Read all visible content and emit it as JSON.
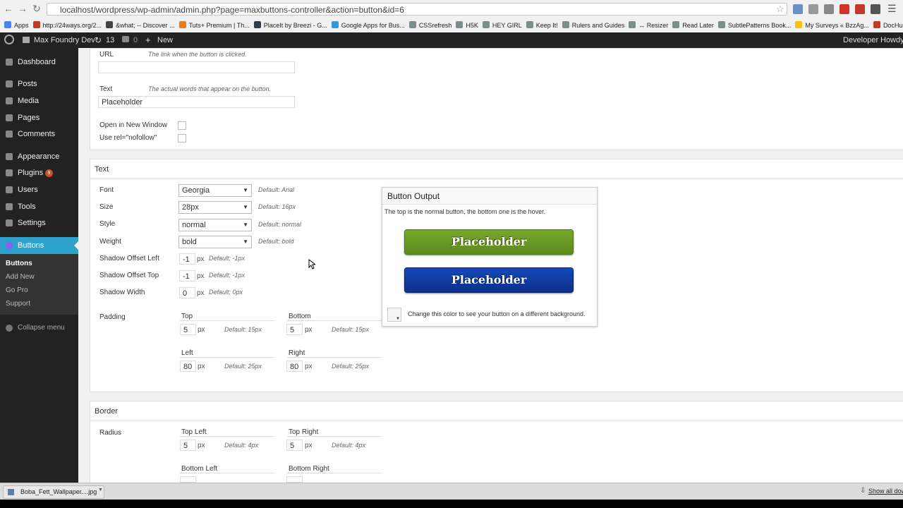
{
  "browser": {
    "url": "localhost/wordpress/wp-admin/admin.php?page=maxbuttons-controller&action=button&id=6",
    "bookmarks": [
      {
        "label": "Apps",
        "color": "#4285f4"
      },
      {
        "label": "http://24ways.org/2...",
        "color": "#c0392b"
      },
      {
        "label": "&what; -- Discover ...",
        "color": "#444444"
      },
      {
        "label": "Tuts+ Premium | Th...",
        "color": "#e67e22"
      },
      {
        "label": "PlaceIt by Breezi - G...",
        "color": "#2c3e50"
      },
      {
        "label": "Google Apps for Bus...",
        "color": "#3498db"
      },
      {
        "label": "CSSrefresh",
        "color": "#7f8c8d"
      },
      {
        "label": "H5K",
        "color": "#7f8c8d"
      },
      {
        "label": "HEY GIRL",
        "color": "#7f8c8d"
      },
      {
        "label": "Keep It!",
        "color": "#7f8c8d"
      },
      {
        "label": "Rulers and Guides",
        "color": "#7f8c8d"
      },
      {
        "label": "↔ Resizer",
        "color": "#7f8c8d"
      },
      {
        "label": "Read Later",
        "color": "#7f8c8d"
      },
      {
        "label": "SubtlePatterns Book...",
        "color": "#7f8c8d"
      },
      {
        "label": "My Surveys « BzzAg...",
        "color": "#f1c40f"
      },
      {
        "label": "DocHub | Instant D",
        "color": "#c0392b"
      }
    ]
  },
  "adminbar": {
    "site": "Max Foundry Dev",
    "updates": "13",
    "comments": "0",
    "new": "New",
    "developer": "Developer",
    "howdy": "Howdy,"
  },
  "sidebar": {
    "items": [
      {
        "label": "Dashboard"
      },
      {
        "label": "Posts"
      },
      {
        "label": "Media"
      },
      {
        "label": "Pages"
      },
      {
        "label": "Comments"
      },
      {
        "label": "Appearance"
      },
      {
        "label": "Plugins",
        "badge": "9"
      },
      {
        "label": "Users"
      },
      {
        "label": "Tools"
      },
      {
        "label": "Settings"
      },
      {
        "label": "Buttons"
      }
    ],
    "submenu": [
      "Buttons",
      "Add New",
      "Go Pro",
      "Support"
    ],
    "collapse": "Collapse menu"
  },
  "basics": {
    "url_label": "URL",
    "url_hint": "The link when the button is clicked.",
    "url_value": "",
    "text_label": "Text",
    "text_hint": "The actual words that appear on the button.",
    "text_value": "Placeholder",
    "new_window": "Open in New Window",
    "nofollow": "Use rel=\"nofollow\""
  },
  "text_section": {
    "title": "Text",
    "font": {
      "label": "Font",
      "value": "Georgia",
      "default": "Default: Arial"
    },
    "size": {
      "label": "Size",
      "value": "28px",
      "default": "Default: 16px"
    },
    "style": {
      "label": "Style",
      "value": "normal",
      "default": "Default: normal"
    },
    "weight": {
      "label": "Weight",
      "value": "bold",
      "default": "Default: bold"
    },
    "shadow_left": {
      "label": "Shadow Offset Left",
      "value": "-1",
      "unit": "px",
      "default": "Default: -1px"
    },
    "shadow_top": {
      "label": "Shadow Offset Top",
      "value": "-1",
      "unit": "px",
      "default": "Default: -1px"
    },
    "shadow_width": {
      "label": "Shadow Width",
      "value": "0",
      "unit": "px",
      "default": "Default: 0px"
    },
    "padding": {
      "label": "Padding",
      "top": {
        "label": "Top",
        "value": "5",
        "unit": "px",
        "default": "Default: 15px"
      },
      "bottom": {
        "label": "Bottom",
        "value": "5",
        "unit": "px",
        "default": "Default: 15px"
      },
      "left": {
        "label": "Left",
        "value": "80",
        "unit": "px",
        "default": "Default: 25px"
      },
      "right": {
        "label": "Right",
        "value": "80",
        "unit": "px",
        "default": "Default: 25px"
      }
    }
  },
  "output": {
    "title": "Button Output",
    "desc": "The top is the normal button, the bottom one is the hover.",
    "button_normal": "Placeholder",
    "button_hover": "Placeholder",
    "normal_color": "#76a82c",
    "hover_color": "#1549b8",
    "bg_note": "Change this color to see your button on a different background."
  },
  "border_section": {
    "title": "Border",
    "radius_label": "Radius",
    "top_left": {
      "label": "Top Left",
      "value": "5",
      "unit": "px",
      "default": "Default: 4px"
    },
    "top_right": {
      "label": "Top Right",
      "value": "5",
      "unit": "px",
      "default": "Default: 4px"
    },
    "bottom_left": {
      "label": "Bottom Left"
    },
    "bottom_right": {
      "label": "Bottom Right"
    }
  },
  "download": {
    "file": "Boba_Fett_Wallpaper....jpg",
    "show_all": "Show all dow"
  }
}
